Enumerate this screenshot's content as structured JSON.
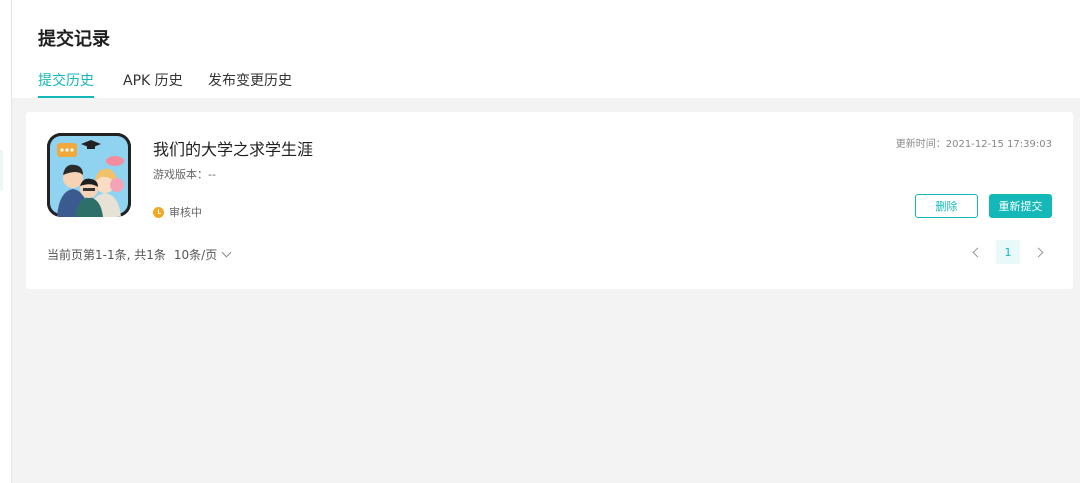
{
  "header": {
    "title": "提交记录",
    "tabs": [
      {
        "label": "提交历史",
        "active": true
      },
      {
        "label": "APK 历史",
        "active": false
      },
      {
        "label": "发布变更历史",
        "active": false
      }
    ]
  },
  "record": {
    "app_name": "我们的大学之求学生涯",
    "version_label": "游戏版本：--",
    "status": "审核中",
    "update_time": "更新时间：2021-12-15 17:39:03",
    "delete_label": "删除",
    "resubmit_label": "重新提交",
    "status_color": "#f5a623",
    "accent_color": "#14b8b8"
  },
  "pagination": {
    "info": "当前页第1-1条, 共1条",
    "page_size": "10条/页",
    "current_page": "1"
  }
}
